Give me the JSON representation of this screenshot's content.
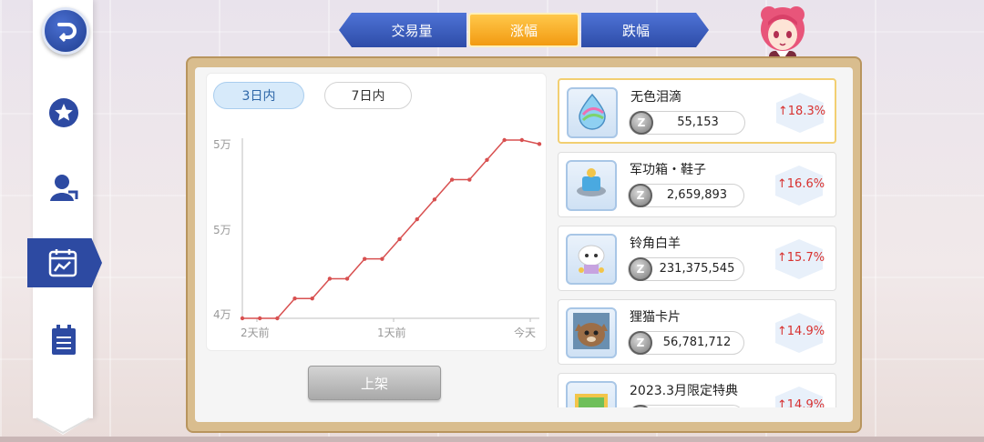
{
  "tabs": {
    "volume": "交易量",
    "rise": "涨幅",
    "fall": "跌幅",
    "active": "rise"
  },
  "nav": {
    "items": [
      "home-icon",
      "star-icon",
      "profile-icon",
      "chart-calendar-icon",
      "clipboard-icon"
    ],
    "active": "chart-calendar-icon"
  },
  "period": {
    "three_day": "3日内",
    "seven_day": "7日内",
    "active": "three_day"
  },
  "chart_data": {
    "type": "line",
    "ytick_labels": [
      "5万",
      "5万",
      "4万"
    ],
    "xtick_labels": [
      "2天前",
      "1天前",
      "今天"
    ],
    "values": [
      0,
      0,
      0,
      1,
      1,
      2,
      2,
      3,
      3,
      4,
      5,
      6,
      7,
      7,
      8,
      9,
      9,
      8.8
    ],
    "color": "#d85050",
    "grid": false
  },
  "shelve_button": "上架",
  "items": [
    {
      "name": "无色泪滴",
      "price": "55,153",
      "change": "↑18.3%",
      "coin": "Z",
      "icon": "teardrop-crystal-icon",
      "selected": true
    },
    {
      "name": "军功箱・鞋子",
      "price": "2,659,893",
      "change": "↑16.6%",
      "coin": "Z",
      "icon": "boots-box-icon",
      "selected": false
    },
    {
      "name": "铃角白羊",
      "price": "231,375,545",
      "change": "↑15.7%",
      "coin": "Z",
      "icon": "white-sheep-icon",
      "selected": false
    },
    {
      "name": "狸猫卡片",
      "price": "56,781,712",
      "change": "↑14.9%",
      "coin": "Z",
      "icon": "raccoon-card-icon",
      "selected": false
    },
    {
      "name": "2023.3月限定特典",
      "price": "",
      "change": "↑14.9%",
      "coin": "Z",
      "icon": "limited-bundle-icon",
      "selected": false
    }
  ]
}
